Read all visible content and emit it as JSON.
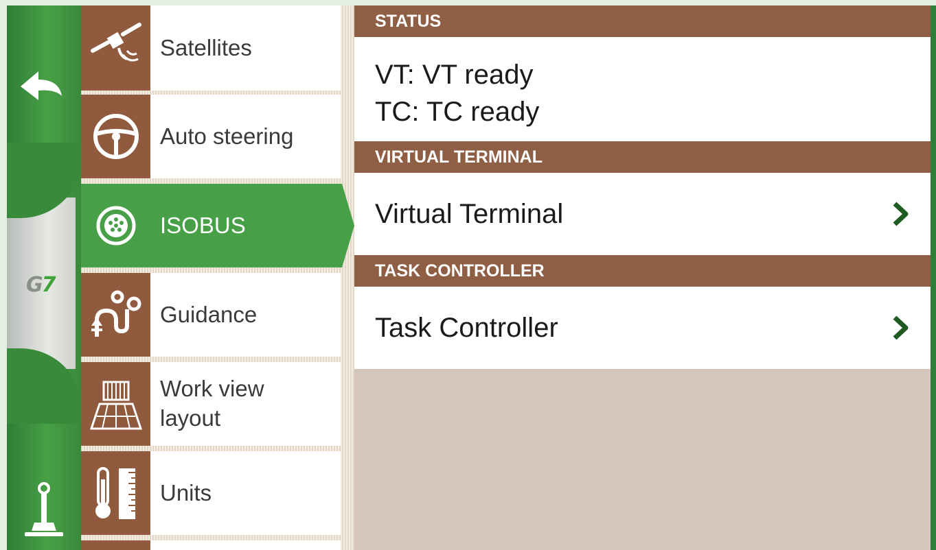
{
  "app": {
    "logo_text_g": "G",
    "logo_text_7": "7"
  },
  "menu": {
    "items": [
      {
        "label": "Satellites",
        "icon": "satellite-icon",
        "active": false
      },
      {
        "label": "Auto steering",
        "icon": "steering-wheel-icon",
        "active": false
      },
      {
        "label": "ISOBUS",
        "icon": "isobus-connector-icon",
        "active": true
      },
      {
        "label": "Guidance",
        "icon": "guidance-icon",
        "active": false
      },
      {
        "label": "Work view\nlayout",
        "icon": "work-view-layout-icon",
        "active": false
      },
      {
        "label": "Units",
        "icon": "thermometer-ruler-icon",
        "active": false
      }
    ]
  },
  "status": {
    "header": "STATUS",
    "vt_line": "VT: VT ready",
    "tc_line": "TC: TC ready"
  },
  "virtual_terminal": {
    "header": "VIRTUAL TERMINAL",
    "row_label": "Virtual Terminal"
  },
  "task_controller": {
    "header": "TASK CONTROLLER",
    "row_label": "Task Controller"
  },
  "colors": {
    "accent_green": "#47a047",
    "header_brown": "#8f5f45",
    "icon_brown": "#8f5a3d",
    "chevron_green": "#1f5a22"
  }
}
